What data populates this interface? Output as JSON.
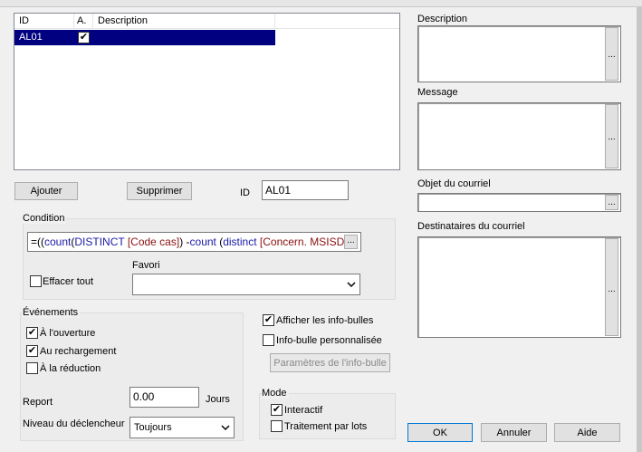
{
  "grid": {
    "columns": [
      "ID",
      "A.",
      "Description"
    ],
    "rows": [
      {
        "id": "AL01",
        "active": true,
        "description": ""
      }
    ]
  },
  "buttons": {
    "add": "Ajouter",
    "delete": "Supprimer",
    "ok": "OK",
    "cancel": "Annuler",
    "help": "Aide",
    "tooltip_params": "Paramètres de l'info-bulle"
  },
  "id_field": {
    "label": "ID",
    "value": "AL01"
  },
  "condition": {
    "label": "Condition",
    "formula_parts": [
      "=((",
      "count",
      "(",
      "DISTINCT",
      " [Code cas]",
      ") -",
      "count",
      " (",
      "distinct",
      " [Concern. MSISD"
    ],
    "clear_all_label": "Effacer tout",
    "favori_label": "Favori",
    "favori_value": ""
  },
  "events": {
    "label": "Événements",
    "on_open": {
      "label": "À l'ouverture",
      "checked": true
    },
    "on_reload": {
      "label": "Au rechargement",
      "checked": true
    },
    "on_reduce": {
      "label": "À la réduction",
      "checked": false
    },
    "report_label": "Report",
    "report_value": "0.00",
    "report_unit": "Jours",
    "trigger_label": "Niveau du déclencheur",
    "trigger_value": "Toujours"
  },
  "tooltips": {
    "show": {
      "label": "Afficher les info-bulles",
      "checked": true
    },
    "custom": {
      "label": "Info-bulle personnalisée",
      "checked": false
    }
  },
  "mode": {
    "label": "Mode",
    "interactive": {
      "label": "Interactif",
      "checked": true
    },
    "batch": {
      "label": "Traitement par lots",
      "checked": false
    }
  },
  "right": {
    "description_label": "Description",
    "message_label": "Message",
    "subject_label": "Objet du courriel",
    "recipients_label": "Destinataires du courriel",
    "ellipsis": "..."
  },
  "check_glyph": "✔"
}
